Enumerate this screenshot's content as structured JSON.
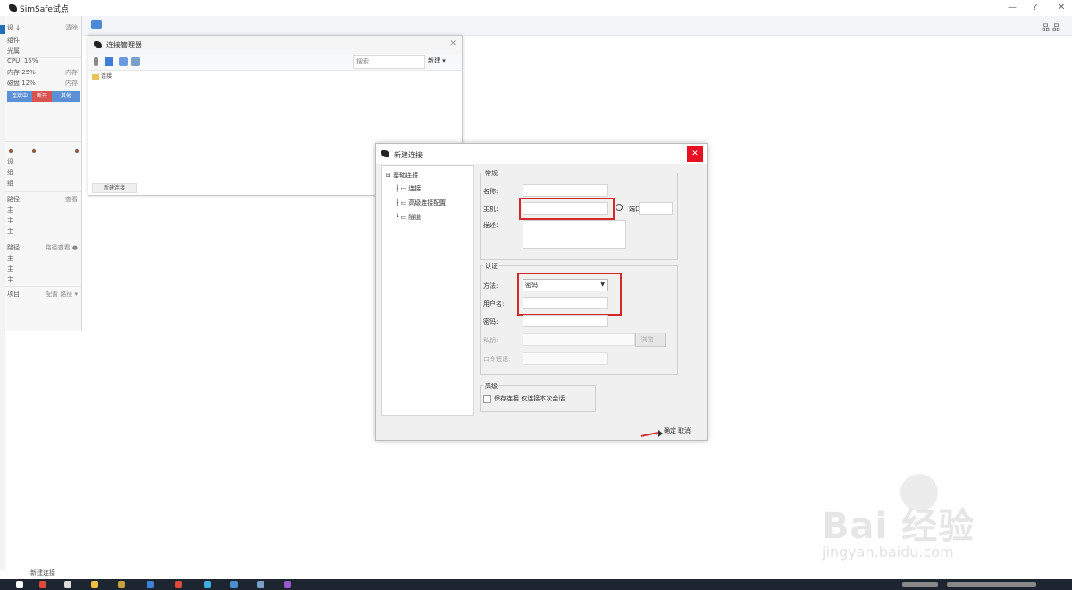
{
  "app": {
    "title": "SimSafe试点",
    "controls": {
      "minimize": "—",
      "help": "?",
      "close": "✕"
    },
    "right_tools": "品 品"
  },
  "left_panel": {
    "header": {
      "left": "设 ↓",
      "right": "清除"
    },
    "rows": [
      {
        "label": "组件",
        "value": ""
      },
      {
        "label": "光属",
        "value": ""
      },
      {
        "label": "CPU:",
        "value": "16%",
        "right": ""
      },
      {
        "label": "内存",
        "value": "25%",
        "right": "内存"
      },
      {
        "label": "磁盘",
        "value": "12%",
        "right": "内存"
      }
    ],
    "segments": [
      {
        "label": "连接中",
        "color": "#5b8fd6"
      },
      {
        "label": "断开",
        "color": "#d9534f"
      },
      {
        "label": "其他",
        "color": "#5b8fd6"
      }
    ],
    "section2": {
      "rows": [
        "设",
        "组",
        "组"
      ]
    },
    "section3": {
      "header_left": "路径",
      "header_right": "查看",
      "rows": [
        "主",
        "主",
        "主"
      ]
    },
    "section4": {
      "header_left": "路径",
      "header_right": "路径查看 ●",
      "rows": [
        "主",
        "主",
        "主"
      ]
    },
    "section5": {
      "left": "项目",
      "right": "配置 路径 ▾"
    }
  },
  "win1": {
    "title": "连接管理器",
    "close": "✕",
    "search_placeholder": "搜索",
    "menu": "新建 ▾",
    "folder": "连接",
    "status": "新建连接"
  },
  "dialog": {
    "title": "新建连接",
    "close": "✕",
    "tree": {
      "root": "基础连接",
      "items": [
        "连接",
        "高级连接配置",
        "隧道"
      ]
    },
    "group1": {
      "label": "常规",
      "name_label": "名称:",
      "name_value": "",
      "host_label": "主机:",
      "host_value": "",
      "port_label": "端口",
      "port_value": "",
      "desc_label": "描述:",
      "desc_value": ""
    },
    "group2": {
      "label": "认证",
      "method_label": "方法:",
      "method_value": "密码",
      "user_label": "用户名:",
      "user_value": "",
      "pass_label": "密码:",
      "pass_value": "",
      "key_label": "私钥:",
      "key_value": "",
      "key_button": "浏览...",
      "phrase_label": "口令短语:",
      "phrase_value": ""
    },
    "group3": {
      "label": "高级",
      "checkbox": "保存连接 仅连接本次会话",
      "checked": false
    },
    "ok": "确定",
    "cancel": "取消"
  },
  "bottom_label": "新建连接",
  "watermark": {
    "logo": "Bai  经验",
    "url": "jingyan.baidu.com"
  },
  "colors": {
    "accent": "#1f6fb8",
    "highlight": "#d12a2a",
    "close": "#e81123"
  }
}
